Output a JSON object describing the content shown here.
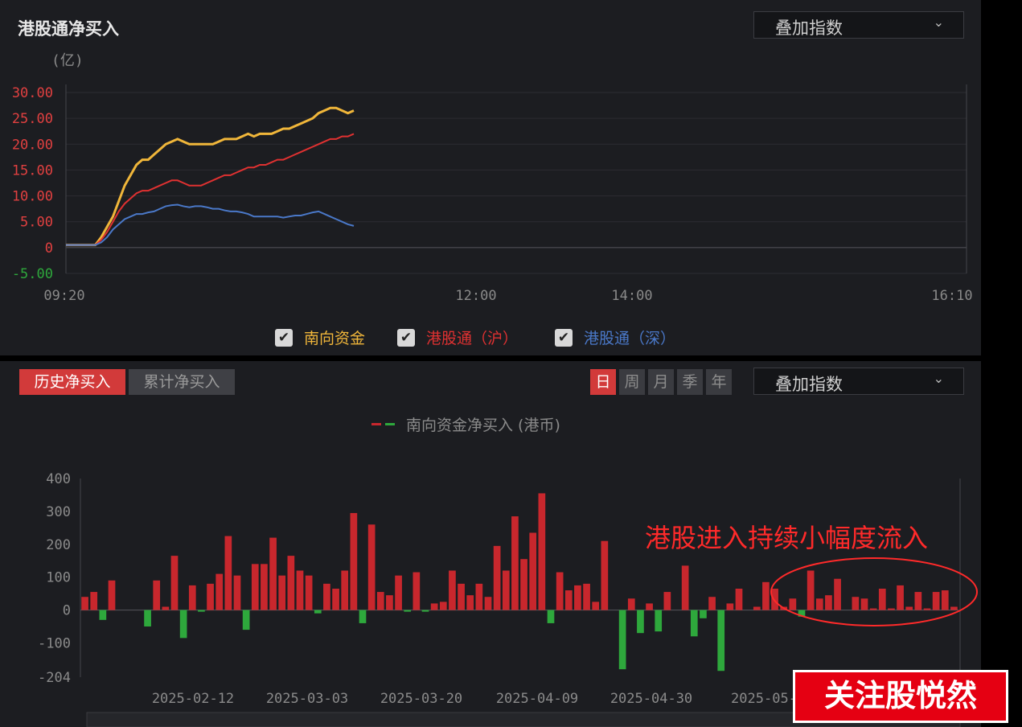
{
  "top_panel": {
    "title": "港股通净买入",
    "overlay_dropdown": "叠加指数",
    "unit_label": "(亿)",
    "legend": [
      {
        "label": "南向资金",
        "color": "#f0b63a",
        "checked": true
      },
      {
        "label": "港股通（沪）",
        "color": "#e03131",
        "checked": true
      },
      {
        "label": "港股通（深）",
        "color": "#4a78c8",
        "checked": true
      }
    ]
  },
  "bottom_panel": {
    "tab_history": "历史净买入",
    "tab_cumulative": "累计净买入",
    "periods": [
      "日",
      "周",
      "月",
      "季",
      "年"
    ],
    "active_period": "日",
    "overlay_dropdown": "叠加指数",
    "legend_label": "南向资金净买入 (港币)",
    "annotation": "港股进入持续小幅度流入"
  },
  "watermark": "关注股悦然",
  "chart_data": [
    {
      "type": "line",
      "ylabel": "(亿)",
      "x_tick_labels": [
        "09:20",
        "12:00",
        "14:00",
        "16:10"
      ],
      "y_tick_labels": [
        "30.00",
        "25.00",
        "20.00",
        "15.00",
        "10.00",
        "5.00",
        "0",
        "-5.00"
      ],
      "ylim": [
        -5,
        30
      ],
      "grid": true,
      "series": [
        {
          "name": "南向资金",
          "color": "#f0b63a",
          "values": [
            0.5,
            0.5,
            0.5,
            0.5,
            0.5,
            0.5,
            2,
            4,
            6,
            9,
            12,
            14,
            16,
            17,
            17,
            18,
            19,
            20,
            20.5,
            21,
            20.5,
            20,
            20,
            20,
            20,
            20,
            20.5,
            21,
            21,
            21,
            21.5,
            22,
            21.5,
            22,
            22,
            22,
            22.5,
            23,
            23,
            23.5,
            24,
            24.5,
            25,
            26,
            26.5,
            27,
            27,
            26.5,
            26,
            26.5
          ]
        },
        {
          "name": "港股通（沪）",
          "color": "#e03131",
          "values": [
            0.5,
            0.5,
            0.5,
            0.5,
            0.5,
            0.5,
            1.5,
            3,
            5,
            7,
            8.5,
            9.5,
            10.5,
            11,
            11,
            11.5,
            12,
            12.5,
            13,
            13,
            12.5,
            12,
            12,
            12,
            12.5,
            13,
            13.5,
            14,
            14,
            14.5,
            15,
            15.5,
            15.5,
            16,
            16,
            16.5,
            17,
            17,
            17.5,
            18,
            18.5,
            19,
            19.5,
            20,
            20.5,
            21,
            21,
            21.5,
            21.5,
            22
          ]
        },
        {
          "name": "港股通（深）",
          "color": "#4a78c8",
          "values": [
            0.5,
            0.5,
            0.5,
            0.5,
            0.5,
            0.5,
            1,
            2,
            3.5,
            4.5,
            5.5,
            6,
            6.5,
            6.5,
            6.8,
            7,
            7.5,
            8,
            8.2,
            8.3,
            8,
            7.8,
            8,
            8,
            7.8,
            7.5,
            7.5,
            7.2,
            7,
            7,
            6.8,
            6.5,
            6,
            6,
            6,
            6,
            6,
            5.8,
            6,
            6.2,
            6.2,
            6.5,
            6.8,
            7,
            6.5,
            6,
            5.5,
            5,
            4.5,
            4.2
          ]
        }
      ]
    },
    {
      "type": "bar",
      "title": "南向资金净买入 (港币)",
      "x_tick_labels": [
        "2025-02-12",
        "2025-03-03",
        "2025-03-20",
        "2025-04-09",
        "2025-04-30",
        "2025-05-"
      ],
      "y_tick_labels": [
        "400",
        "300",
        "200",
        "100",
        "0",
        "-100",
        "-204"
      ],
      "ylim": [
        -204,
        400
      ],
      "positive_color": "#c8272d",
      "negative_color": "#2ea83c",
      "values": [
        40,
        55,
        -30,
        90,
        0,
        0,
        0,
        -50,
        90,
        10,
        165,
        -85,
        75,
        -5,
        80,
        110,
        225,
        105,
        -60,
        140,
        140,
        220,
        105,
        165,
        120,
        105,
        -10,
        80,
        65,
        120,
        295,
        -40,
        260,
        55,
        45,
        105,
        -5,
        115,
        -5,
        20,
        25,
        120,
        80,
        45,
        80,
        40,
        195,
        120,
        285,
        155,
        235,
        355,
        -40,
        115,
        60,
        75,
        80,
        25,
        210,
        0,
        -180,
        35,
        -70,
        20,
        -65,
        55,
        0,
        135,
        -80,
        -25,
        40,
        -185,
        20,
        65,
        0,
        10,
        85,
        65,
        10,
        35,
        -20,
        120,
        35,
        45,
        95,
        0,
        40,
        35,
        5,
        65,
        5,
        75,
        10,
        55,
        5,
        55,
        60,
        10
      ]
    }
  ]
}
